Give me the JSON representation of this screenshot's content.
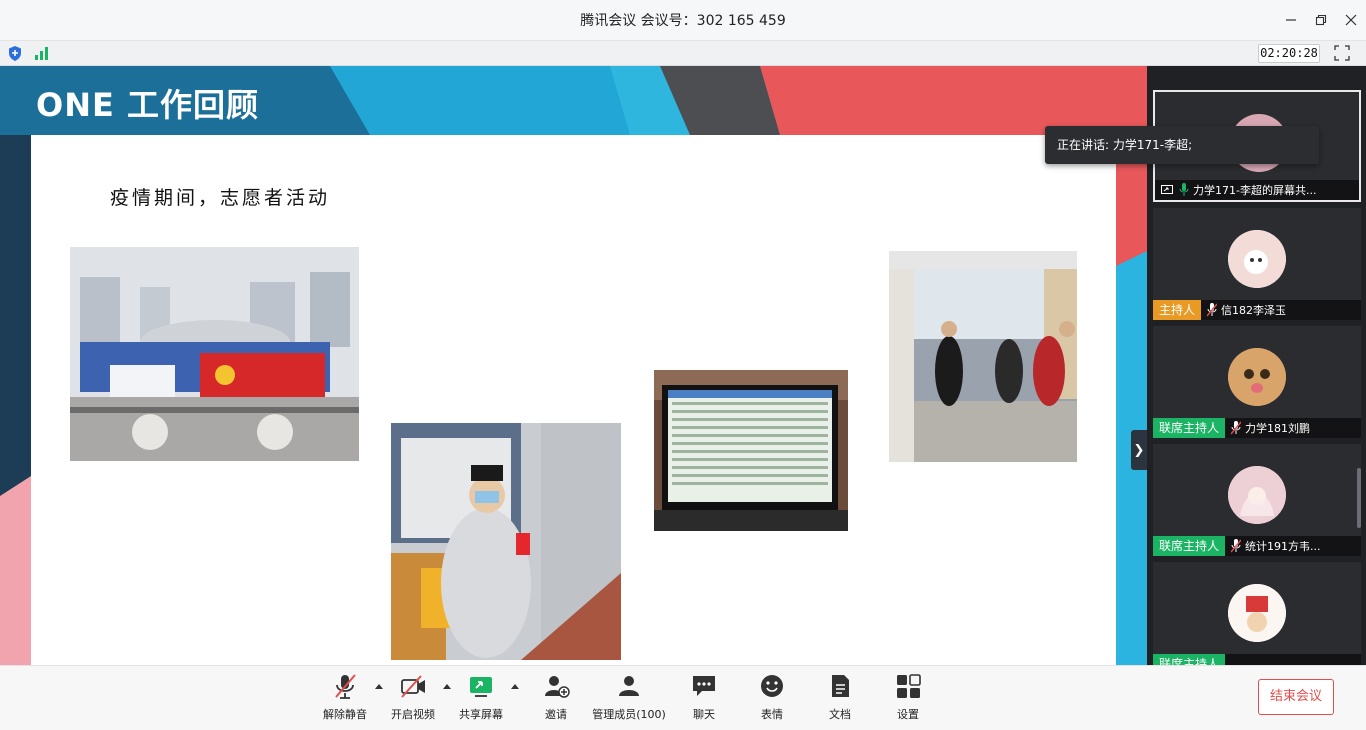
{
  "window": {
    "title": "腾讯会议 会议号：302 165 459",
    "minimize_icon": "minimize-icon",
    "restore_icon": "restore-icon",
    "close_icon": "close-icon"
  },
  "status": {
    "timer": "02:20:28"
  },
  "slide": {
    "title": "ONE 工作回顾",
    "subtitle": "疫情期间，志愿者活动"
  },
  "speaking": {
    "text": "正在讲话: 力学171-李超;"
  },
  "participants": [
    {
      "role": "",
      "name": "力学171-李超的屏幕共..."
    },
    {
      "role": "主持人",
      "name": "信182李泽玉"
    },
    {
      "role": "联席主持人",
      "name": "力学181刘鹏"
    },
    {
      "role": "联席主持人",
      "name": "统计191方韦..."
    },
    {
      "role": "联席主持人",
      "name": ""
    }
  ],
  "toolbar": {
    "mute_label": "解除静音",
    "video_label": "开启视频",
    "share_label": "共享屏幕",
    "invite_label": "邀请",
    "members_label": "管理成员(100)",
    "chat_label": "聊天",
    "reaction_label": "表情",
    "docs_label": "文档",
    "settings_label": "设置",
    "end_label": "结束会议"
  },
  "colors": {
    "accent_blue": "#1f9ed8",
    "accent_red": "#e85656",
    "host_orange": "#e89a25",
    "cohost_green": "#1bb464",
    "end_red": "#e34d4d"
  }
}
